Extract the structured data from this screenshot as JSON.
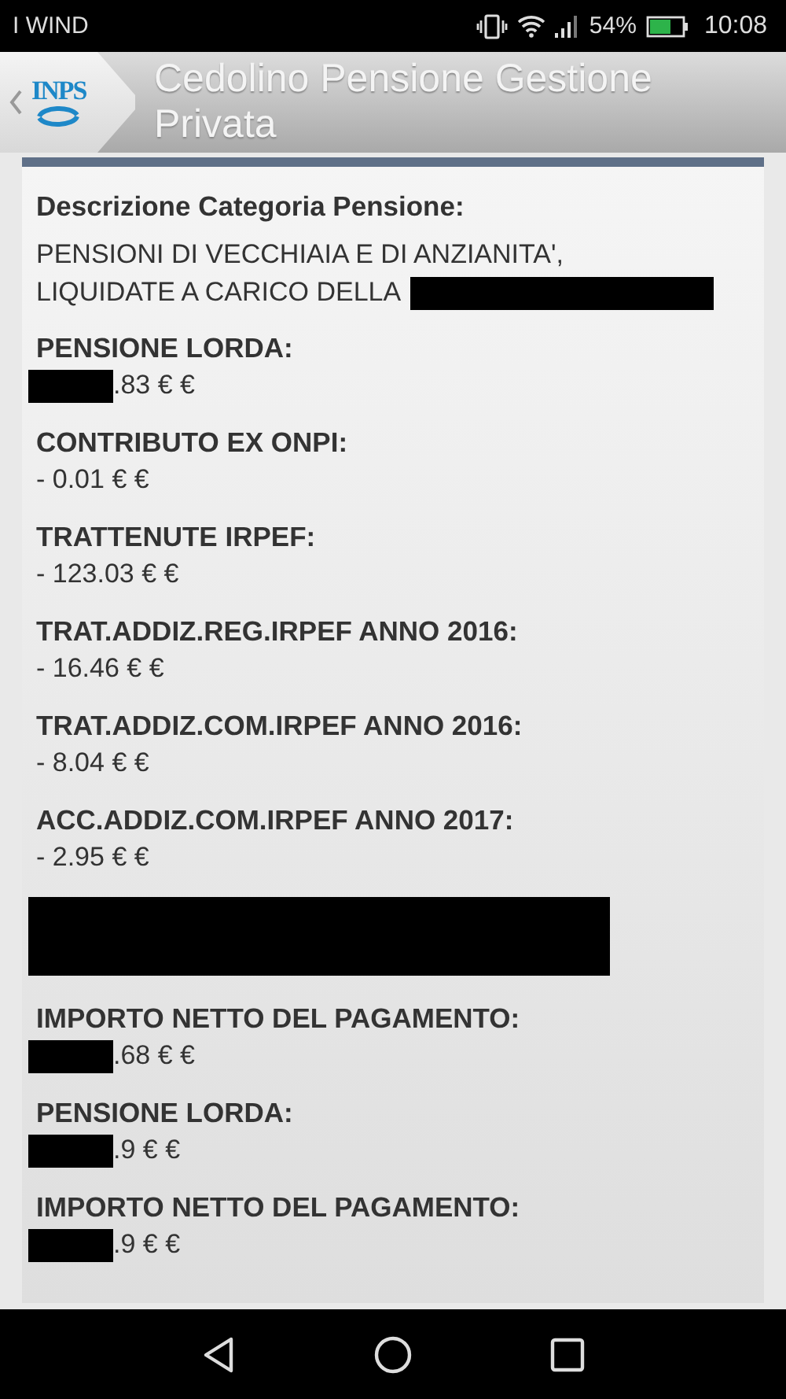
{
  "status_bar": {
    "carrier": "I WIND",
    "battery_percent": "54%",
    "time": "10:08"
  },
  "header": {
    "logo_text": "INPS",
    "title": "Cedolino Pensione Gestione Privata"
  },
  "items": [
    {
      "kind": "text",
      "label": "Descrizione Categoria Pensione:",
      "lines": [
        "PENSIONI DI VECCHIAIA E DI ANZIANITA',",
        "LIQUIDATE A CARICO DELLA"
      ],
      "redacted": true
    },
    {
      "kind": "amount",
      "label": "PENSIONE LORDA:",
      "value": ".83 € €",
      "redacted": true
    },
    {
      "kind": "amount",
      "label": "CONTRIBUTO EX ONPI:",
      "value": "- 0.01 € €",
      "redacted": false
    },
    {
      "kind": "amount",
      "label": "TRATTENUTE IRPEF:",
      "value": "- 123.03 € €",
      "redacted": false
    },
    {
      "kind": "amount",
      "label": "TRAT.ADDIZ.REG.IRPEF ANNO 2016:",
      "value": "- 16.46 € €",
      "redacted": false
    },
    {
      "kind": "amount",
      "label": "TRAT.ADDIZ.COM.IRPEF ANNO 2016:",
      "value": "- 8.04 € €",
      "redacted": false
    },
    {
      "kind": "amount",
      "label": "ACC.ADDIZ.COM.IRPEF ANNO 2017:",
      "value": "- 2.95 € €",
      "redacted": false
    },
    {
      "kind": "redaction"
    },
    {
      "kind": "amount",
      "label": "IMPORTO NETTO DEL PAGAMENTO:",
      "value": ".68 € €",
      "redacted": true
    },
    {
      "kind": "amount",
      "label": "PENSIONE LORDA:",
      "value": ".9 € €",
      "redacted": true
    },
    {
      "kind": "amount",
      "label": "IMPORTO NETTO DEL PAGAMENTO:",
      "value": ".9 € €",
      "redacted": true
    }
  ]
}
